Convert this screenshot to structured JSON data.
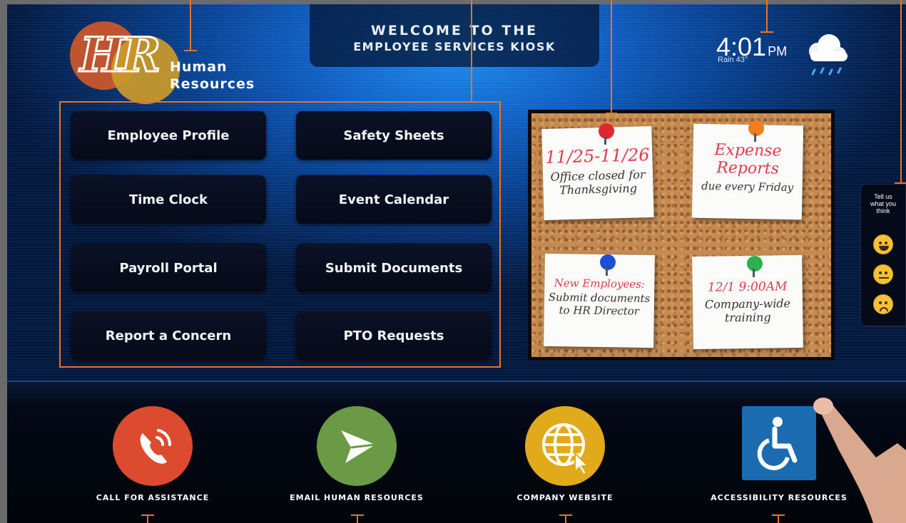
{
  "logo": {
    "letters": "HR",
    "line1": "Human",
    "line2": "Resources"
  },
  "header": {
    "welcome_line1": "WELCOME TO THE",
    "welcome_line2": "EMPLOYEE SERVICES KIOSK"
  },
  "clock": {
    "time": "4:01",
    "ampm": "PM",
    "weather": "Rain 43°",
    "weather_icon": "rain-cloud-icon"
  },
  "menu": {
    "buttons": [
      "Employee Profile",
      "Safety Sheets",
      "Time Clock",
      "Event Calendar",
      "Payroll Portal",
      "Submit Documents",
      "Report a Concern",
      "PTO Requests"
    ]
  },
  "board": {
    "notes": [
      {
        "highlight": "11/25-11/26",
        "lines": [
          "Office closed for",
          "Thanksgiving"
        ],
        "pin_color": "#e0262e"
      },
      {
        "highlight": "Expense",
        "highlight2": "Reports",
        "lines": [
          "due every Friday"
        ],
        "pin_color": "#f07f1e"
      },
      {
        "highlight": "New Employees:",
        "lines": [
          "Submit documents",
          "to HR Director"
        ],
        "pin_color": "#1c4fd6"
      },
      {
        "highlight": "12/1 9:00AM",
        "lines": [
          "Company-wide",
          "training"
        ],
        "pin_color": "#2bb24c"
      }
    ]
  },
  "feedback": {
    "title_line1": "Tell us",
    "title_line2": "what you",
    "title_line3": "think",
    "faces": [
      "happy-face-icon",
      "neutral-face-icon",
      "sad-face-icon"
    ]
  },
  "actions": {
    "call": {
      "label": "CALL FOR ASSISTANCE",
      "icon": "phone-icon",
      "color": "#dc4b2f"
    },
    "email": {
      "label": "EMAIL HUMAN RESOURCES",
      "icon": "paper-plane-icon",
      "color": "#6b9a47"
    },
    "website": {
      "label": "COMPANY WEBSITE",
      "icon": "globe-icon",
      "color": "#e0aa1b"
    },
    "accessibility": {
      "label": "ACCESSIBILITY RESOURCES",
      "icon": "wheelchair-icon",
      "color": "#1a6bb0"
    }
  },
  "colors": {
    "accent_orange": "#e8742a",
    "note_red": "#e33b4e"
  }
}
